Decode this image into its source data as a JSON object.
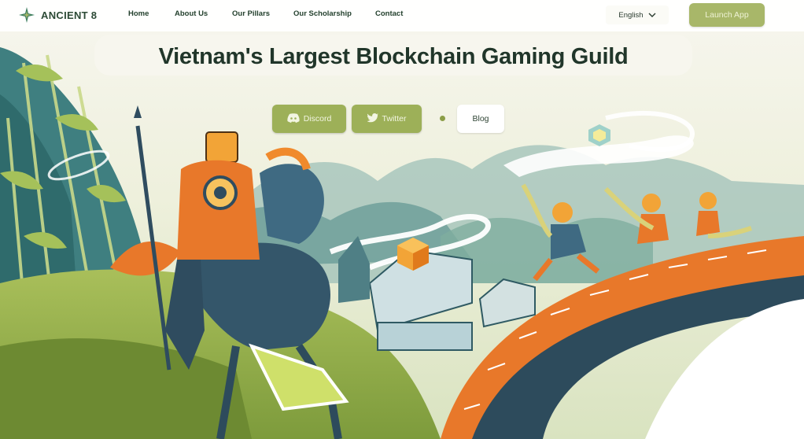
{
  "brand": {
    "name": "ANCIENT 8"
  },
  "nav": {
    "items": [
      {
        "label": "Home"
      },
      {
        "label": "About Us"
      },
      {
        "label": "Our Pillars"
      },
      {
        "label": "Our Scholarship"
      },
      {
        "label": "Contact"
      }
    ]
  },
  "language": {
    "selected": "English"
  },
  "launch": {
    "label": "Launch App"
  },
  "hero": {
    "title": "Vietnam's Largest Blockchain Gaming Guild"
  },
  "socials": {
    "discord_label": "Discord",
    "twitter_label": "Twitter",
    "blog_label": "Blog"
  },
  "colors": {
    "accent_green": "#9db058",
    "heading": "#21362a",
    "orange": "#e8782a",
    "teal": "#3f7f80"
  },
  "icons": [
    "ancient8-logo-icon",
    "chevron-down-icon",
    "discord-icon",
    "twitter-icon"
  ]
}
